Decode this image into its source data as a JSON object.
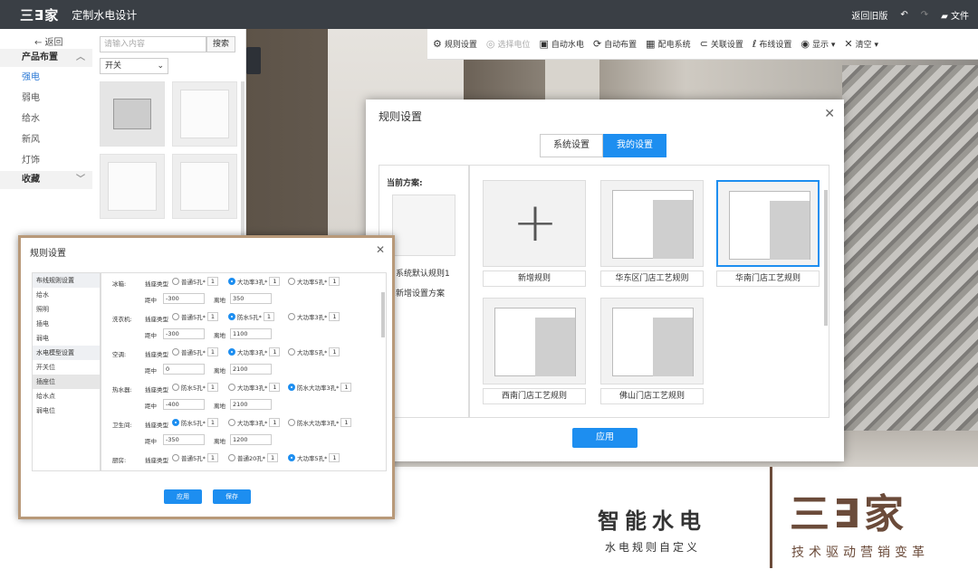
{
  "topbar": {
    "logo": "三∃家",
    "title": "定制水电设计",
    "back_old": "返回旧版",
    "undo": "↶",
    "redo": "↷",
    "file_label": "文件"
  },
  "toolbar": {
    "items": [
      {
        "icon": "gear-icon",
        "glyph": "⚙",
        "label": "规则设置",
        "disabled": false
      },
      {
        "icon": "socket-icon",
        "glyph": "◎",
        "label": "选择电位",
        "disabled": true
      },
      {
        "icon": "auto-icon",
        "glyph": "▣",
        "label": "自动水电",
        "disabled": false
      },
      {
        "icon": "layout-icon",
        "glyph": "⟳",
        "label": "自动布置",
        "disabled": false
      },
      {
        "icon": "distribution-icon",
        "glyph": "▦",
        "label": "配电系统",
        "disabled": false
      },
      {
        "icon": "link-icon",
        "glyph": "⊂",
        "label": "关联设置",
        "disabled": false
      },
      {
        "icon": "wiring-icon",
        "glyph": "ℓ",
        "label": "布线设置",
        "disabled": false
      },
      {
        "icon": "eye-icon",
        "glyph": "◉",
        "label": "显示 ▾",
        "disabled": false
      },
      {
        "icon": "clear-icon",
        "glyph": "✕",
        "label": "清空 ▾",
        "disabled": false
      }
    ]
  },
  "leftpanel": {
    "back": "← 返回",
    "cat_head": "产品布置",
    "cats": [
      "强电",
      "弱电",
      "给水",
      "新风",
      "灯饰"
    ],
    "fav": "收藏",
    "search_placeholder": "请输入内容",
    "search_btn": "搜索",
    "type_select": "开关"
  },
  "rules_modal": {
    "title": "规则设置",
    "tabs": [
      "系统设置",
      "我的设置"
    ],
    "current_label": "当前方案:",
    "current_name": "系统默认规则1",
    "add_scheme": "新增设置方案",
    "cards": [
      "新增规则",
      "华东区门店工艺规则",
      "华南门店工艺规则",
      "西南门店工艺规则",
      "佛山门店工艺规则"
    ],
    "apply": "应用"
  },
  "small_modal": {
    "title": "规则设置",
    "sections": [
      {
        "head": "布线规则设置",
        "items": [
          "给水",
          "照明",
          "插电",
          "弱电"
        ]
      },
      {
        "head": "水电模型设置",
        "items": [
          "开关位",
          "插座位",
          "给水点",
          "弱电位"
        ]
      }
    ],
    "type_label": "插座类型",
    "dist_label": "距中",
    "height_label": "离地",
    "rows": [
      {
        "name": "冰箱:",
        "opts": [
          "普通5孔*",
          "大功率3孔*",
          "大功率5孔*"
        ],
        "sel": 1,
        "dist": "-300",
        "height": "350"
      },
      {
        "name": "洗衣机:",
        "opts": [
          "普通5孔*",
          "防水5孔*",
          "大功率3孔*"
        ],
        "sel": 1,
        "dist": "-300",
        "height": "1100"
      },
      {
        "name": "空调:",
        "opts": [
          "普通5孔*",
          "大功率3孔*",
          "大功率5孔*"
        ],
        "sel": 1,
        "dist": "0",
        "height": "2100"
      },
      {
        "name": "热水器:",
        "opts": [
          "防水5孔*",
          "大功率3孔*",
          "防水大功率3孔*"
        ],
        "sel": 2,
        "dist": "-400",
        "height": "2100"
      },
      {
        "name": "卫生间:",
        "opts": [
          "防水5孔*",
          "大功率3孔*",
          "防水大功率3孔*"
        ],
        "sel": 0,
        "dist": "-350",
        "height": "1200"
      },
      {
        "name": "厨房:",
        "opts": [
          "普通5孔*",
          "普通20孔*",
          "大功率5孔*"
        ],
        "sel": 2,
        "dist": "",
        "height": ""
      }
    ],
    "count": "1",
    "apply": "应用",
    "save": "保存"
  },
  "watermark": {
    "main": "智能水电",
    "sub": "水电规则自定义",
    "logo": "三∃家",
    "slogan": "技术驱动营销变革"
  }
}
